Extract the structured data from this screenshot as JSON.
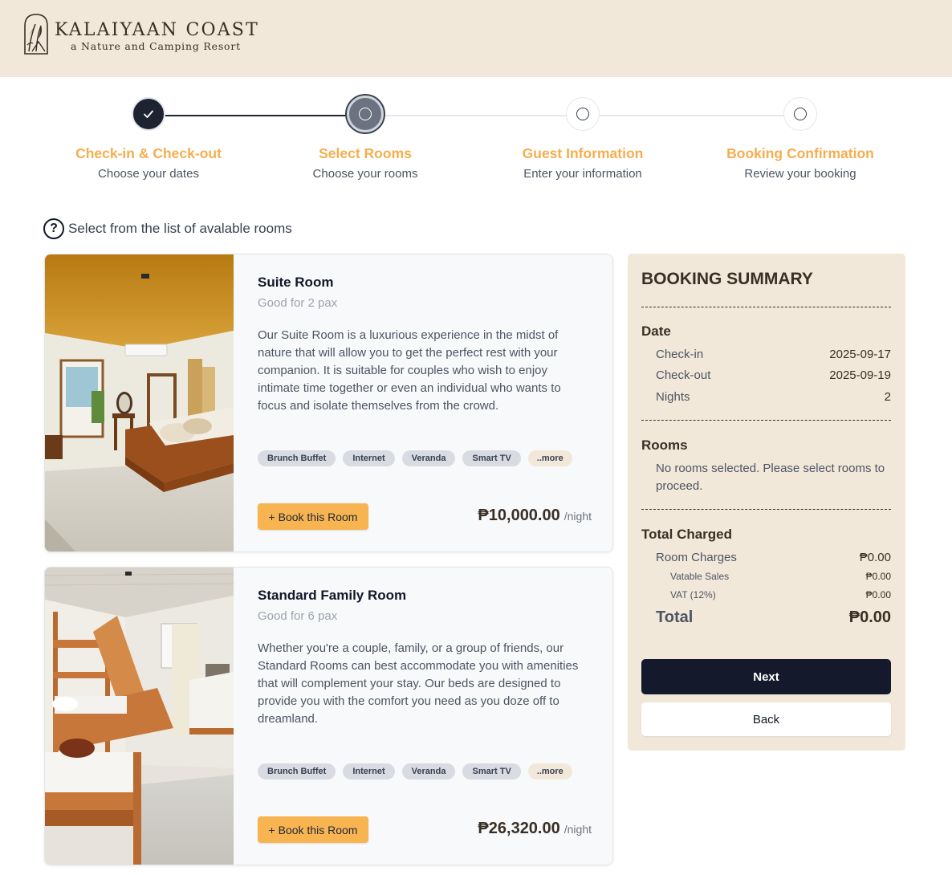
{
  "brand": {
    "name": "KALAIYAAN COAST",
    "tagline": "a Nature and Camping Resort"
  },
  "stepper": {
    "steps": [
      {
        "title": "Check-in & Check-out",
        "subtitle": "Choose your dates",
        "state": "done"
      },
      {
        "title": "Select Rooms",
        "subtitle": "Choose your rooms",
        "state": "active"
      },
      {
        "title": "Guest Information",
        "subtitle": "Enter your information",
        "state": "todo"
      },
      {
        "title": "Booking Confirmation",
        "subtitle": "Review your booking",
        "state": "todo"
      }
    ]
  },
  "hint": {
    "icon": "question-circle-icon",
    "text": "Select from the list of avalable rooms"
  },
  "rooms": [
    {
      "name": "Suite Room",
      "pax": "Good for 2 pax",
      "description": "Our Suite Room is a luxurious experience in the midst of nature that will allow you to get the perfect rest with your companion. It is suitable for couples who wish to enjoy intimate time together or even an individual who wants to focus and isolate themselves from the crowd.",
      "tags": [
        "Brunch Buffet",
        "Internet",
        "Veranda",
        "Smart TV"
      ],
      "more_label": "..more",
      "book_label": "+ Book this Room",
      "price": "₱10,000.00",
      "price_unit": "/night"
    },
    {
      "name": "Standard Family Room",
      "pax": "Good for 6 pax",
      "description": "Whether you're a couple, family, or a group of friends, our Standard Rooms can best accommodate you with amenities that will complement your stay. Our beds are designed to provide you with the comfort you need as you doze off to dreamland.",
      "tags": [
        "Brunch Buffet",
        "Internet",
        "Veranda",
        "Smart TV"
      ],
      "more_label": "..more",
      "book_label": "+ Book this Room",
      "price": "₱26,320.00",
      "price_unit": "/night"
    }
  ],
  "summary": {
    "title": "BOOKING SUMMARY",
    "date_heading": "Date",
    "checkin_label": "Check-in",
    "checkin_value": "2025-09-17",
    "checkout_label": "Check-out",
    "checkout_value": "2025-09-19",
    "nights_label": "Nights",
    "nights_value": "2",
    "rooms_heading": "Rooms",
    "rooms_note": "No rooms selected. Please select rooms to proceed.",
    "total_heading": "Total Charged",
    "room_charges_label": "Room Charges",
    "room_charges_value": "₱0.00",
    "vatable_label": "Vatable Sales",
    "vatable_value": "₱0.00",
    "vat_label": "VAT (12%)",
    "vat_value": "₱0.00",
    "total_label": "Total",
    "total_value": "₱0.00",
    "next_label": "Next",
    "back_label": "Back"
  },
  "colors": {
    "header_bg": "#f2e8da",
    "accent_orange": "#f5ae4e",
    "button_orange": "#f8b451",
    "dark_navy": "#141a2b",
    "brown_text": "#3a2f25"
  }
}
